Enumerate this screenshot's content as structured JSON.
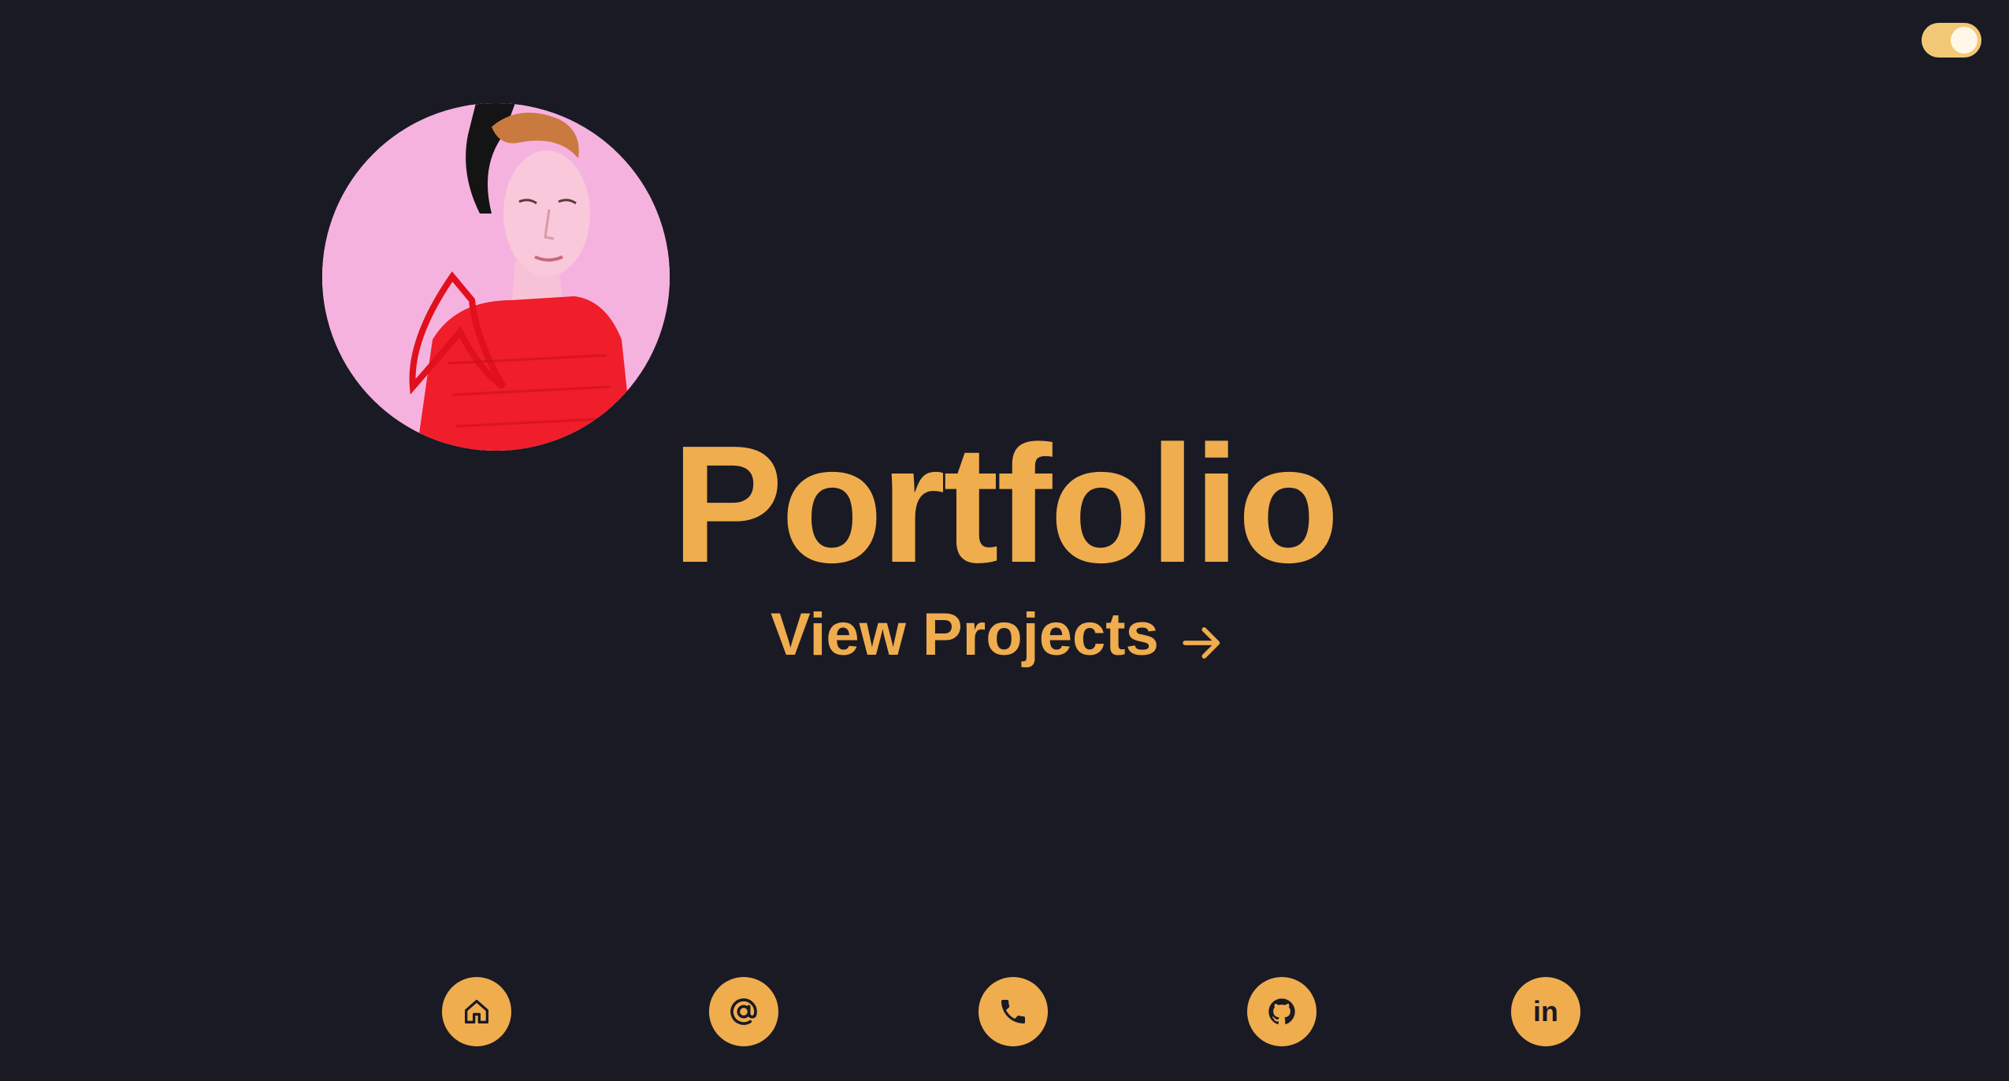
{
  "theme_toggle": {
    "state": "on",
    "accent_color": "#f2c877"
  },
  "avatar": {
    "alt": "profile-photo"
  },
  "hero": {
    "title": "Portfolio",
    "cta_label": "View Projects",
    "cta_icon": "arrow-right-icon"
  },
  "nav": {
    "items": [
      {
        "icon": "home-icon"
      },
      {
        "icon": "at-sign-icon"
      },
      {
        "icon": "phone-icon"
      },
      {
        "icon": "github-icon"
      },
      {
        "icon": "linkedin-icon",
        "label": "in"
      }
    ]
  },
  "colors": {
    "background": "#1a1a24",
    "accent": "#f0ad4e"
  }
}
